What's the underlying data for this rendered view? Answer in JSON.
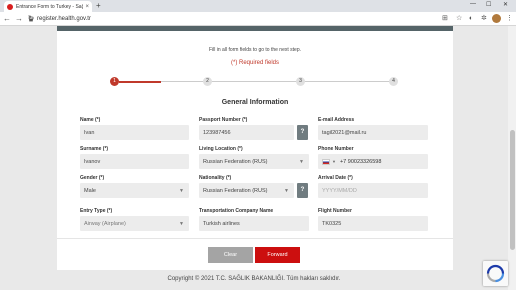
{
  "browser": {
    "tab_title": "Entrance Form to Turkey - Sağlık",
    "url": "register.health.gov.tr"
  },
  "form": {
    "instruction": "Fill in all form fields to go to the next step.",
    "required_note": "(*) Required fields",
    "section_title": "General Information",
    "steps": [
      "1",
      "2",
      "3",
      "4"
    ],
    "active_step": 1,
    "fields": {
      "name": {
        "label": "Name (*)",
        "value": "Ivan"
      },
      "passport": {
        "label": "Passport Number (*)",
        "value": "123987456"
      },
      "email": {
        "label": "E-mail Address",
        "value": "tagil2021@mail.ru"
      },
      "surname": {
        "label": "Surname (*)",
        "value": "Ivanov"
      },
      "living": {
        "label": "Living Location (*)",
        "value": "Russian Federation (RUS)"
      },
      "phone": {
        "label": "Phone Number",
        "value": "+7 90023326598",
        "code": "+7"
      },
      "gender": {
        "label": "Gender (*)",
        "value": "Male"
      },
      "nationality": {
        "label": "Nationality (*)",
        "value": "Russian Federation (RUS)"
      },
      "arrival": {
        "label": "Arrival Date (*)",
        "placeholder": "YYYY/MM/DD"
      },
      "entry_type": {
        "label": "Entry Type (*)",
        "value": "Airway (Airplane)"
      },
      "transport": {
        "label": "Transportation Company Name",
        "value": "Turkish airlines"
      },
      "flight": {
        "label": "Flight Number",
        "value": "TK0325"
      }
    },
    "buttons": {
      "clear": "Clear",
      "forward": "Forward"
    }
  },
  "footer": "Copyright © 2021 T.C. SAĞLIK BAKANLIĞI. Tüm hakları saklıdır.",
  "colors": {
    "accent": "#c0392b",
    "forward_button": "#cc0f0f",
    "card_topbar": "#556468"
  },
  "icons": [
    "close-icon",
    "plus-icon",
    "back-icon",
    "forward-nav-icon",
    "reload-icon",
    "lock-icon",
    "help-icon",
    "chevron-down-icon",
    "russia-flag-icon",
    "recaptcha-icon"
  ]
}
